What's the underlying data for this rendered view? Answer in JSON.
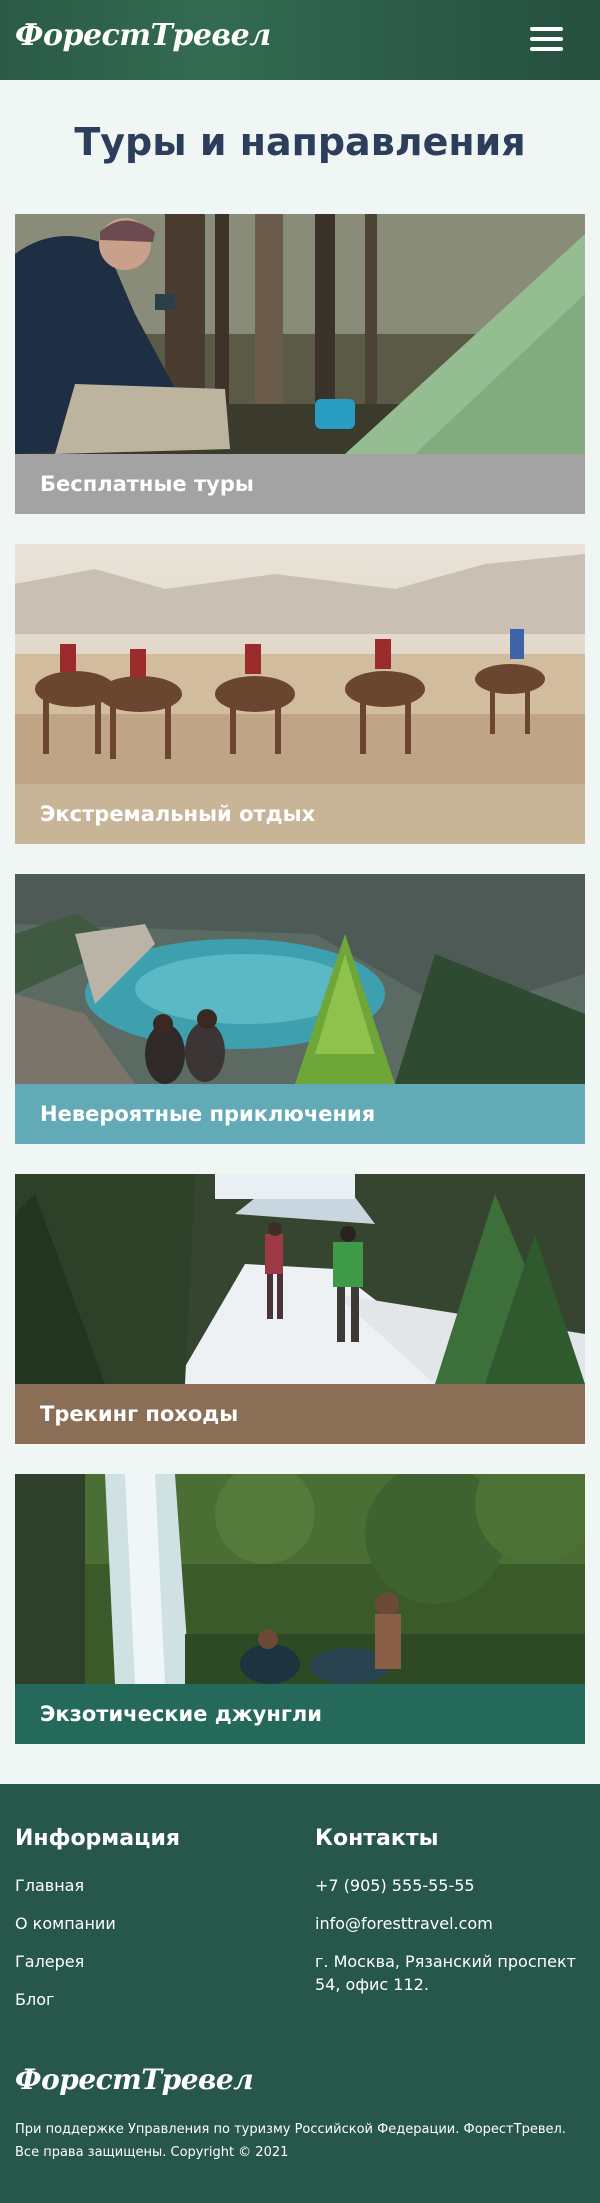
{
  "header": {
    "logo": "ФорестТревел",
    "menu_icon": "hamburger-menu-icon"
  },
  "main": {
    "title": "Туры и направления",
    "cards": [
      {
        "label": "Бесплатные туры",
        "color": "#a3a3a3",
        "image": "camping-tent-forest-photo"
      },
      {
        "label": "Экстремальный отдых",
        "color": "#c8b598",
        "image": "camel-caravan-desert-photo"
      },
      {
        "label": "Невероятные приключения",
        "color": "#63aab7",
        "image": "mountain-lake-hikers-photo"
      },
      {
        "label": "Трекинг походы",
        "color": "#8a6e55",
        "image": "snow-trail-trekkers-photo"
      },
      {
        "label": "Экзотические джунгли",
        "color": "#25695a",
        "image": "jungle-waterfall-photo"
      }
    ]
  },
  "footer": {
    "info": {
      "title": "Информация",
      "links": [
        "Главная",
        "О компании",
        "Галерея",
        "Блог"
      ]
    },
    "contacts": {
      "title": "Контакты",
      "phone": "+7 (905) 555-55-55",
      "email": "info@foresttravel.com",
      "address": "г. Москва, Рязанский проспект 54, офис 112."
    },
    "logo": "ФорестТревел",
    "copyright": "При поддержке Управления по туризму Российской Федерации.  ФорестТревел. Все права защищены. Copyright © 2021"
  },
  "colors": {
    "header_bg": "#2f634c",
    "page_bg": "#f0f6f3",
    "title": "#2c3e5c",
    "footer_bg": "#27574a"
  }
}
